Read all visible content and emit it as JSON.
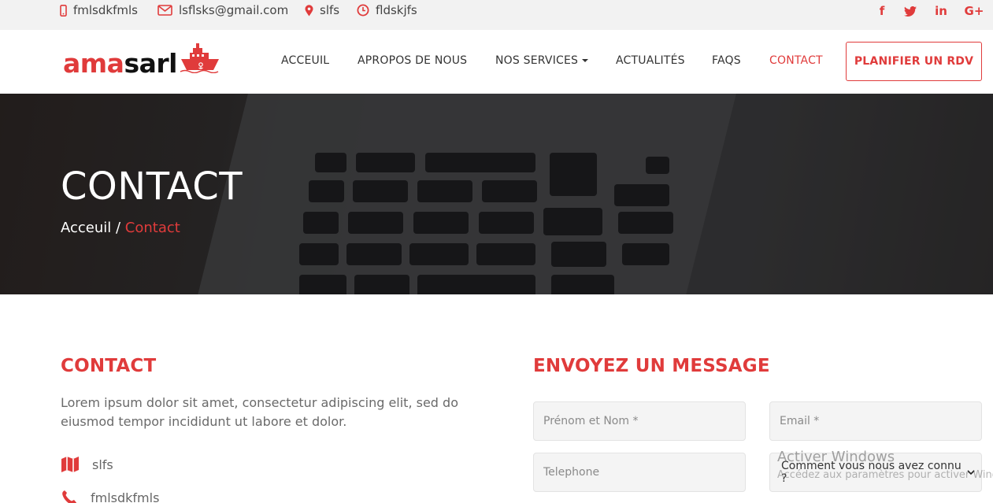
{
  "topbar": {
    "phone": "fmlsdkfmls",
    "email": "lsflsks@gmail.com",
    "location": "slfs",
    "hours": "fldskjfs",
    "social": {
      "facebook": "f",
      "twitter": "twitter-icon",
      "linkedin": "in",
      "googleplus": "G+"
    }
  },
  "brand": {
    "part1": "ama",
    "part2": "sarl"
  },
  "nav": {
    "items": [
      "ACCEUIL",
      "APROPOS DE NOUS",
      "NOS SERVICES",
      "ACTUALITÉS",
      "FAQS",
      "CONTACT"
    ],
    "cta": "PLANIFIER UN RDV"
  },
  "hero": {
    "title": "CONTACT",
    "breadcrumb_home": "Acceuil",
    "breadcrumb_sep": " / ",
    "breadcrumb_current": "Contact"
  },
  "contact": {
    "title": "CONTACT",
    "description": "Lorem ipsum dolor sit amet, consectetur adipiscing elit, sed do eiusmod tempor incididunt ut labore et dolor.",
    "address": "slfs",
    "phone": "fmlsdkfmls"
  },
  "form": {
    "title": "ENVOYEZ UN MESSAGE",
    "name_placeholder": "Prénom et Nom *",
    "email_placeholder": "Email *",
    "phone_placeholder": "Telephone",
    "source_select": "Comment vous nous avez connu ?"
  },
  "watermark": {
    "title": "Activer Windows",
    "subtitle": "Accédez aux paramètres pour activer Windows."
  },
  "colors": {
    "accent": "#e03b3b",
    "topbar_bg": "#f2f2f2",
    "field_bg": "#f4f4f4"
  }
}
